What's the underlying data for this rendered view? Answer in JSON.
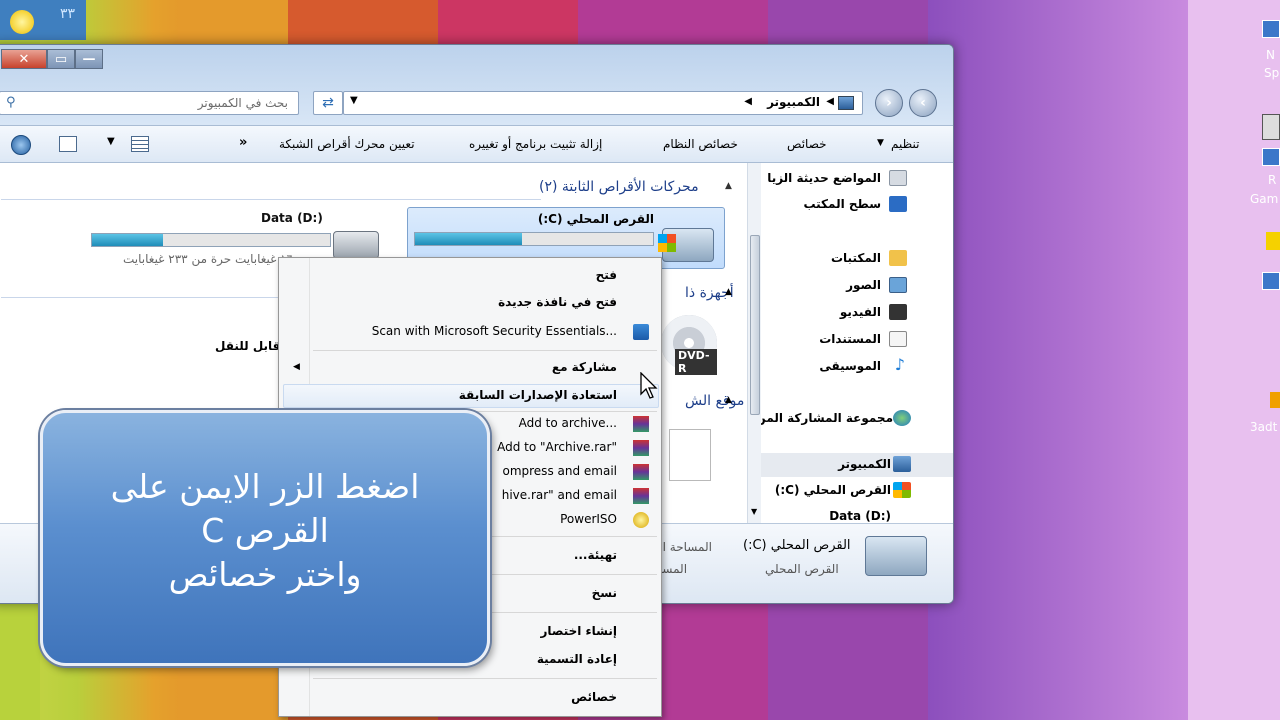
{
  "window": {
    "title_buttons": {
      "close": "✕",
      "maximize": "▭",
      "minimize": "—"
    },
    "search_placeholder": "بحث في الكمبيوتر",
    "breadcrumb": [
      "الكمبيوتر"
    ],
    "toolbar": {
      "organize": "تنظيم",
      "properties": "خصائص",
      "system_properties": "خصائص النظام",
      "uninstall": "إزالة تثبيت برنامج أو تغييره",
      "map_drive": "تعيين محرك أقراص الشبكة",
      "more": "»"
    },
    "nav": {
      "recent": "المواضع حديثة الزيا",
      "desktop": "سطح المكتب",
      "libraries": "المكتبات",
      "pictures": "الصور",
      "videos": "الفيديو",
      "documents": "المستندات",
      "music": "الموسيقى",
      "homegroup": "مجموعة المشاركة المن",
      "computer": "الكمبيوتر",
      "local_disk_c": "القرص المحلي (C:)",
      "data_d": "Data (D:)"
    },
    "content": {
      "hdd_group": "محركات الأقراص الثابتة (٢)",
      "removable_group": "أجهزة ذا",
      "network_group": "موقع الش",
      "drive_c_name": "القرص المحلي (C:)",
      "drive_d_name": "Data (D:)",
      "drive_d_free": "١٦٠ غيغابايت حرة من ٢٣٣ غيغابايت",
      "removable_label": "قابل للنقل",
      "dvd_label": "DVD-R"
    },
    "details": {
      "name": "القرص المحلي (C:)",
      "type": "القرص المحلي",
      "used_label": "المساحة الم",
      "free_label": "المساح"
    }
  },
  "usage": {
    "drive_c_used": 0.45,
    "drive_d_used": 0.3
  },
  "context_menu": {
    "open": "فتح",
    "open_new_window": "فتح في نافذة جديدة",
    "scan": "Scan with Microsoft Security Essentials...",
    "share_with": "مشاركة مع",
    "restore_versions": "استعادة الإصدارات السابقة",
    "add_to_archive": "Add to archive...",
    "add_to_rar": "Add to \"Archive.rar\"",
    "compress_email": "ompress and email",
    "compress_rar_email": "hive.rar\" and email",
    "poweriso": "PowerISO",
    "format": "تهيئة...",
    "copy": "نسخ",
    "create_shortcut": "إنشاء اختصار",
    "rename": "إعادة التسمية",
    "properties": "خصائص"
  },
  "callout": {
    "line1": "اضغط الزر الايمن على",
    "line2": "C القرص",
    "line3": "واختر خصائص"
  },
  "desktop_right": {
    "label1": "N",
    "label2": "Sp",
    "label3": "R",
    "label4": "Gam",
    "label5": "3adt"
  },
  "tray_digits": "٣٣"
}
